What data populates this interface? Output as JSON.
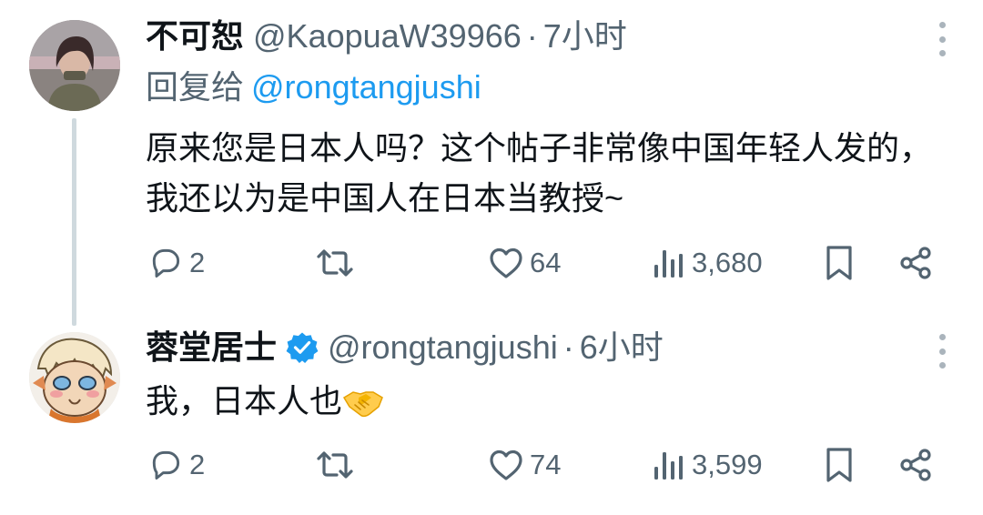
{
  "tweets": [
    {
      "display_name": "不可恕",
      "handle": "@KaopuaW39966",
      "separator": "·",
      "time": "7小时",
      "replying_prefix": "回复给",
      "replying_to": "@rongtangjushi",
      "text": "原来您是日本人吗？这个帖子非常像中国年轻人发的，我还以为是中国人在日本当教授~",
      "reply_count": "2",
      "retweet_count": "",
      "like_count": "64",
      "view_count": "3,680",
      "verified": false
    },
    {
      "display_name": "蓉堂居士",
      "handle": "@rongtangjushi",
      "separator": "·",
      "time": "6小时",
      "text": "我，日本人也",
      "emoji": "handshake",
      "reply_count": "2",
      "retweet_count": "",
      "like_count": "74",
      "view_count": "3,599",
      "verified": true
    }
  ],
  "colors": {
    "text": "#0f1419",
    "secondary": "#536471",
    "accent": "#1d9bf0",
    "thread_line": "#cfd9de"
  },
  "icons": [
    "reply-icon",
    "retweet-icon",
    "like-icon",
    "views-icon",
    "bookmark-icon",
    "share-icon",
    "more-icon",
    "verified-badge-icon",
    "handshake-emoji"
  ]
}
